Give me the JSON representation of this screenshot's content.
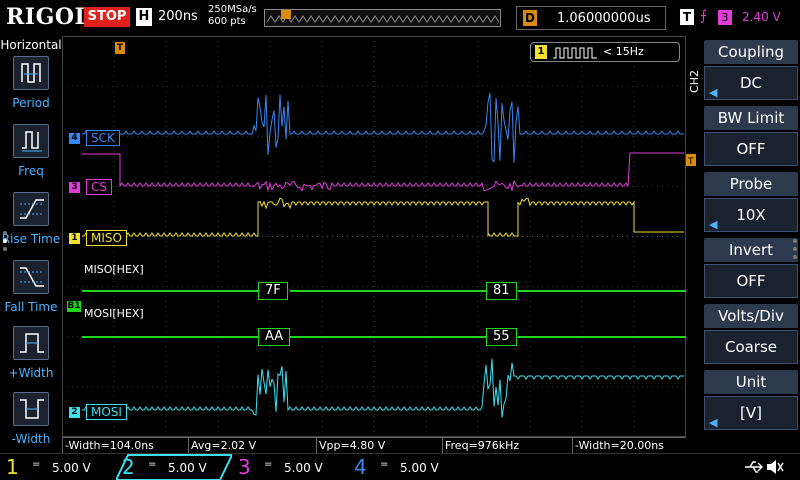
{
  "brand": "RIGOL",
  "top": {
    "run_state": "STOP",
    "timebase_label": "H",
    "timebase_value": "200ns",
    "sample_rate": "250MSa/s",
    "memory_depth": "600 pts",
    "delay_label": "D",
    "delay_value": "1.06000000us",
    "trigger_label": "T",
    "trigger_edge_glyph": "⨍",
    "trigger_source": "3",
    "trigger_level": "2.40 V"
  },
  "left_menu": {
    "title": "Horizontal",
    "items": [
      {
        "label": "Period",
        "icon": "period-icon"
      },
      {
        "label": "Freq",
        "icon": "freq-icon"
      },
      {
        "label": "Rise Time",
        "icon": "rise-time-icon"
      },
      {
        "label": "Fall Time",
        "icon": "fall-time-icon"
      },
      {
        "label": "+Width",
        "icon": "positive-width-icon"
      },
      {
        "label": "-Width",
        "icon": "negative-width-icon"
      }
    ]
  },
  "right_menu": {
    "channel_tag": "CH2",
    "items": [
      {
        "title": "Coupling",
        "value": "DC"
      },
      {
        "title": "BW Limit",
        "value": "OFF"
      },
      {
        "title": "Probe",
        "value": "10X"
      },
      {
        "title": "Invert",
        "value": "OFF"
      },
      {
        "title": "Volts/Div",
        "value": "Coarse"
      },
      {
        "title": "Unit",
        "value": "[V]"
      }
    ]
  },
  "screen": {
    "trigger_marker": "T",
    "trigger_freq_num": "1",
    "trigger_freq_value": "< 15Hz",
    "channels": [
      {
        "num": "4",
        "label": "SCK",
        "color": "#3a86f0"
      },
      {
        "num": "3",
        "label": "CS",
        "color": "#e03cd8"
      },
      {
        "num": "1",
        "label": "MISO",
        "color": "#f0e030"
      },
      {
        "num": "2",
        "label": "MOSI",
        "color": "#3ee0f0"
      }
    ],
    "bus1_marker": "B1",
    "bus1_miso_label": "MISO[HEX]",
    "bus1_mosi_label": "MOSI[HEX]",
    "bus_color": "#22d31f",
    "miso_values": [
      "7F",
      "81"
    ],
    "mosi_values": [
      "AA",
      "55"
    ]
  },
  "measurements": [
    "-Width=104.0ns",
    "Avg=2.02 V",
    "Vpp=4.80 V",
    "Freq=976kHz",
    "-Width=20.00ns"
  ],
  "bottom": {
    "channels": [
      {
        "num": "1",
        "coupling": "=",
        "scale": "5.00 V",
        "color": "#f0e030"
      },
      {
        "num": "2",
        "coupling": "=",
        "scale": "5.00 V",
        "color": "#3ee0f0"
      },
      {
        "num": "3",
        "coupling": "=",
        "scale": "5.00 V",
        "color": "#e03cd8"
      },
      {
        "num": "4",
        "coupling": "=",
        "scale": "5.00 V",
        "color": "#3a86f0"
      }
    ]
  }
}
